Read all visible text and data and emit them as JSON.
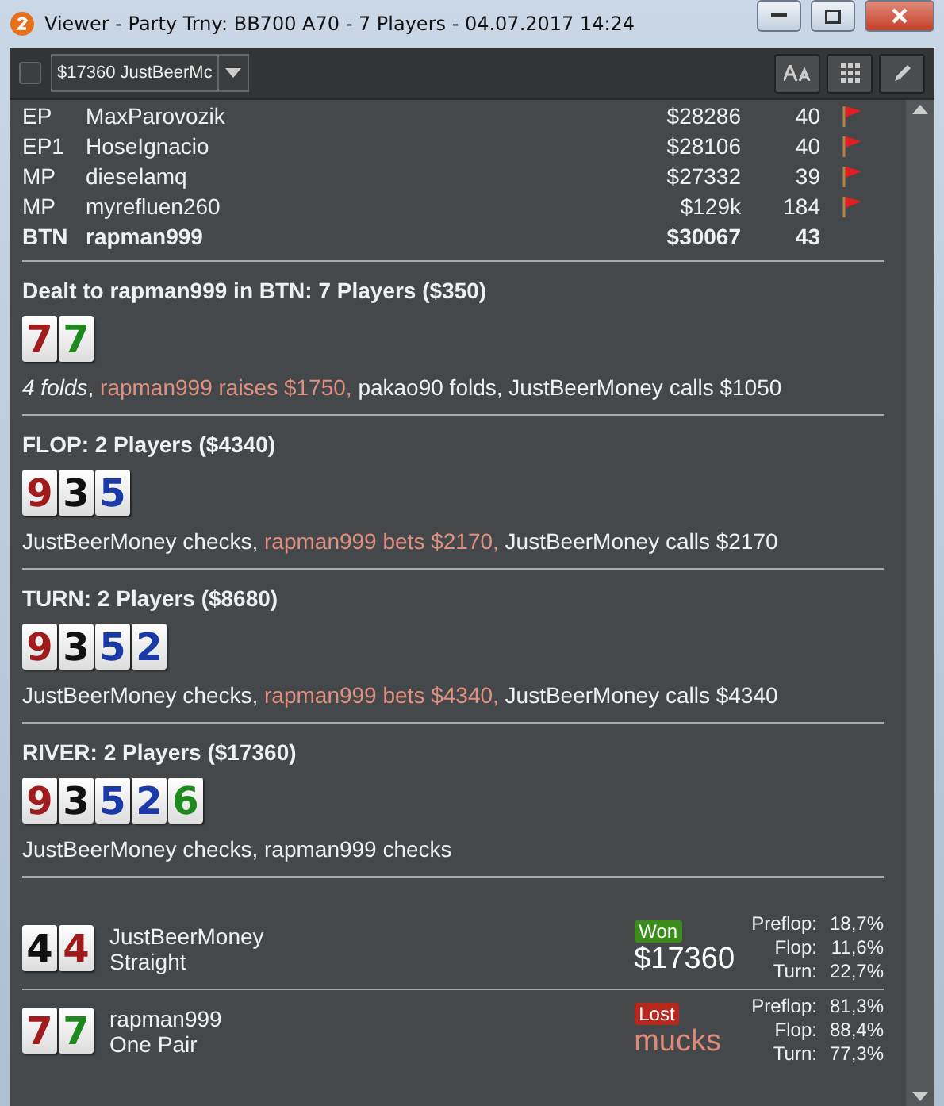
{
  "window": {
    "title": "Viewer - Party Trny: BB700 A70 - 7 Players - 04.07.2017 14:24"
  },
  "toolbar": {
    "checked": false,
    "hand_select": "$17360 JustBeerMc"
  },
  "players": [
    {
      "position": "EP",
      "name": "MaxParovozik",
      "stack": "$28286",
      "hands": "40",
      "hero": false,
      "flag": true
    },
    {
      "position": "EP1",
      "name": "HoseIgnacio",
      "stack": "$28106",
      "hands": "40",
      "hero": false,
      "flag": true
    },
    {
      "position": "MP",
      "name": "dieselamq",
      "stack": "$27332",
      "hands": "39",
      "hero": false,
      "flag": true
    },
    {
      "position": "MP",
      "name": "myrefluen260",
      "stack": "$129k",
      "hands": "184",
      "hero": false,
      "flag": true
    },
    {
      "position": "BTN",
      "name": "rapman999",
      "stack": "$30067",
      "hands": "43",
      "hero": true,
      "flag": false
    }
  ],
  "streets": [
    {
      "heading": "Dealt to rapman999 in BTN: 7 Players ($350)",
      "cards": [
        {
          "rank": "7",
          "color": "#a01c1c"
        },
        {
          "rank": "7",
          "color": "#1e8a1e"
        }
      ],
      "actions": [
        {
          "kind": "plain",
          "text": "*4 folds*, "
        },
        {
          "kind": "hero",
          "text": "rapman999 raises $1750,"
        },
        {
          "kind": "plain",
          "text": " pakao90 folds, JustBeerMoney calls $1050"
        }
      ]
    },
    {
      "heading": "FLOP: 2 Players ($4340)",
      "cards": [
        {
          "rank": "9",
          "color": "#a01c1c"
        },
        {
          "rank": "3",
          "color": "#111111"
        },
        {
          "rank": "5",
          "color": "#1a3aa8"
        }
      ],
      "actions": [
        {
          "kind": "plain",
          "text": "JustBeerMoney checks, "
        },
        {
          "kind": "hero",
          "text": "rapman999 bets $2170,"
        },
        {
          "kind": "plain",
          "text": " JustBeerMoney calls $2170"
        }
      ]
    },
    {
      "heading": "TURN: 2 Players ($8680)",
      "cards": [
        {
          "rank": "9",
          "color": "#a01c1c"
        },
        {
          "rank": "3",
          "color": "#111111"
        },
        {
          "rank": "5",
          "color": "#1a3aa8"
        },
        {
          "rank": "2",
          "color": "#1a3aa8"
        }
      ],
      "actions": [
        {
          "kind": "plain",
          "text": "JustBeerMoney checks, "
        },
        {
          "kind": "hero",
          "text": "rapman999 bets $4340,"
        },
        {
          "kind": "plain",
          "text": " JustBeerMoney calls $4340"
        }
      ]
    },
    {
      "heading": "RIVER: 2 Players ($17360)",
      "cards": [
        {
          "rank": "9",
          "color": "#a01c1c"
        },
        {
          "rank": "3",
          "color": "#111111"
        },
        {
          "rank": "5",
          "color": "#1a3aa8"
        },
        {
          "rank": "2",
          "color": "#1a3aa8"
        },
        {
          "rank": "6",
          "color": "#1e8a1e"
        }
      ],
      "actions": [
        {
          "kind": "plain",
          "text": "JustBeerMoney checks, rapman999 checks"
        }
      ]
    }
  ],
  "results": [
    {
      "cards": [
        {
          "rank": "4",
          "color": "#111111"
        },
        {
          "rank": "4",
          "color": "#a01c1c"
        }
      ],
      "name": "JustBeerMoney",
      "hand": "Straight",
      "won": true,
      "badge": "Won",
      "amount": "$17360",
      "equity": [
        {
          "label": "Preflop:",
          "value": "18,7%"
        },
        {
          "label": "Flop:",
          "value": "11,6%"
        },
        {
          "label": "Turn:",
          "value": "22,7%"
        }
      ]
    },
    {
      "cards": [
        {
          "rank": "7",
          "color": "#a01c1c"
        },
        {
          "rank": "7",
          "color": "#1e8a1e"
        }
      ],
      "name": "rapman999",
      "hand": "One Pair",
      "won": false,
      "badge": "Lost",
      "amount": "mucks",
      "equity": [
        {
          "label": "Preflop:",
          "value": "81,3%"
        },
        {
          "label": "Flop:",
          "value": "88,4%"
        },
        {
          "label": "Turn:",
          "value": "77,3%"
        }
      ]
    }
  ]
}
